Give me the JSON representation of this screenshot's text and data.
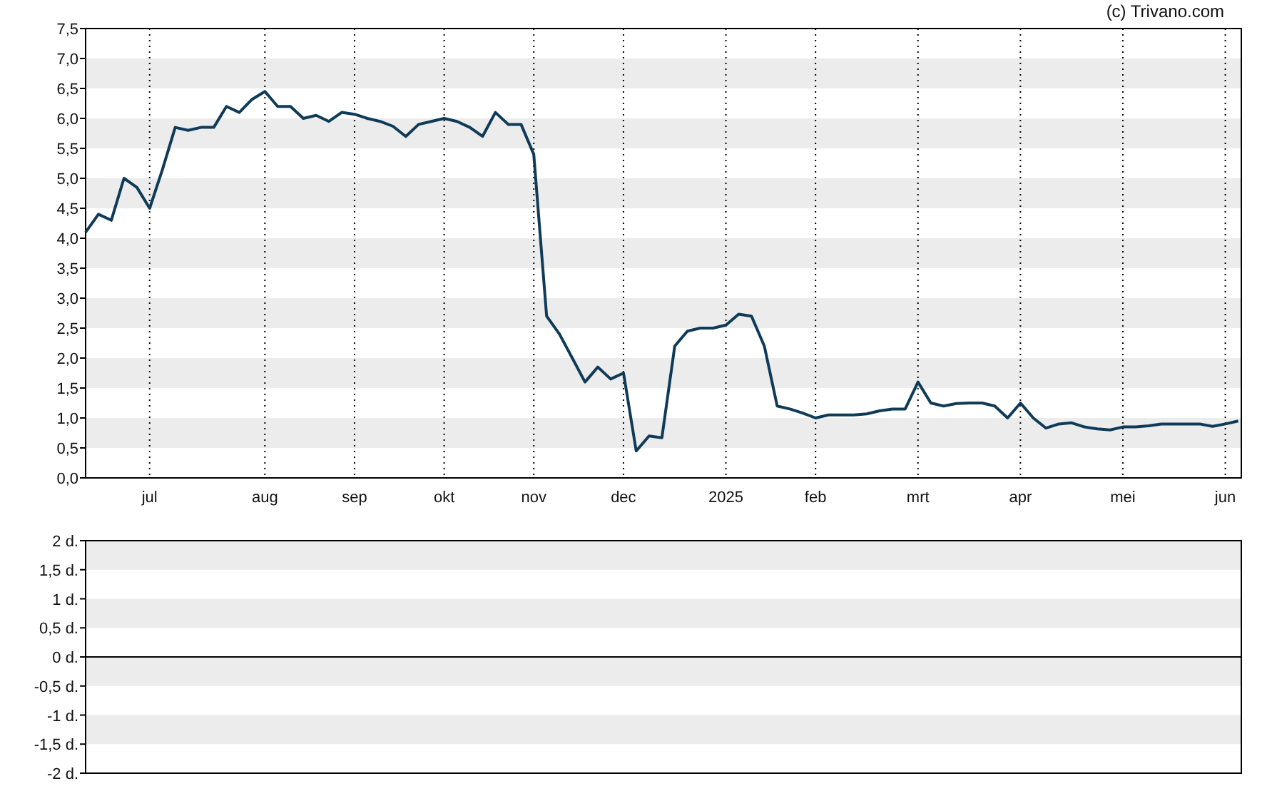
{
  "copyright": "(c) Trivano.com",
  "price_chart": {
    "chart_data": {
      "type": "line",
      "grid": true,
      "ylim": [
        0,
        7.5
      ],
      "yticks": [
        {
          "value": 0,
          "label": "0,0"
        },
        {
          "value": 0.5,
          "label": "0,5"
        },
        {
          "value": 1,
          "label": "1,0"
        },
        {
          "value": 1.5,
          "label": "1,5"
        },
        {
          "value": 2,
          "label": "2,0"
        },
        {
          "value": 2.5,
          "label": "2,5"
        },
        {
          "value": 3,
          "label": "3,0"
        },
        {
          "value": 3.5,
          "label": "3,5"
        },
        {
          "value": 4,
          "label": "4,0"
        },
        {
          "value": 4.5,
          "label": "4,5"
        },
        {
          "value": 5,
          "label": "5,0"
        },
        {
          "value": 5.5,
          "label": "5,5"
        },
        {
          "value": 6,
          "label": "6,0"
        },
        {
          "value": 6.5,
          "label": "6,5"
        },
        {
          "value": 7,
          "label": "7,0"
        },
        {
          "value": 7.5,
          "label": "7,5"
        }
      ],
      "categories": [
        null,
        null,
        null,
        null,
        null,
        "jul",
        null,
        null,
        null,
        null,
        null,
        null,
        null,
        null,
        "aug",
        null,
        null,
        null,
        null,
        null,
        null,
        "sep",
        null,
        null,
        null,
        null,
        null,
        null,
        "okt",
        null,
        null,
        null,
        null,
        null,
        null,
        "nov",
        null,
        null,
        null,
        null,
        null,
        null,
        "dec",
        null,
        null,
        null,
        null,
        null,
        null,
        null,
        "2025",
        null,
        null,
        null,
        null,
        null,
        null,
        "feb",
        null,
        null,
        null,
        null,
        null,
        null,
        null,
        "mrt",
        null,
        null,
        null,
        null,
        null,
        null,
        null,
        "apr",
        null,
        null,
        null,
        null,
        null,
        null,
        null,
        "mei",
        null,
        null,
        null,
        null,
        null,
        null,
        null,
        "jun",
        null
      ],
      "series": [
        {
          "color": "#0f3b59",
          "values": [
            4.1,
            4.4,
            4.3,
            5.0,
            4.85,
            4.5,
            5.15,
            5.85,
            5.8,
            5.85,
            5.85,
            6.2,
            6.1,
            6.32,
            6.45,
            6.2,
            6.2,
            6.0,
            6.05,
            5.95,
            6.1,
            6.07,
            6.0,
            5.95,
            5.87,
            5.7,
            5.9,
            5.95,
            6.0,
            5.95,
            5.85,
            5.7,
            6.1,
            5.9,
            5.9,
            5.4,
            2.7,
            2.4,
            2.0,
            1.6,
            1.85,
            1.65,
            1.75,
            0.45,
            0.7,
            0.67,
            2.2,
            2.45,
            2.5,
            2.5,
            2.55,
            2.73,
            2.7,
            2.2,
            1.2,
            1.15,
            1.08,
            1.0,
            1.05,
            1.05,
            1.05,
            1.07,
            1.12,
            1.15,
            1.15,
            1.6,
            1.25,
            1.2,
            1.24,
            1.25,
            1.25,
            1.2,
            1.0,
            1.25,
            1.0,
            0.83,
            0.9,
            0.92,
            0.85,
            0.82,
            0.8,
            0.85,
            0.85,
            0.87,
            0.9,
            0.9,
            0.9,
            0.9,
            0.86,
            0.9,
            0.95
          ]
        }
      ]
    }
  },
  "days_chart": {
    "chart_data": {
      "type": "line",
      "grid": true,
      "ylim": [
        -2,
        2
      ],
      "categories": [
        null,
        null
      ],
      "yticks": [
        {
          "value": -2,
          "label": "-2 d."
        },
        {
          "value": -1.5,
          "label": "-1,5 d."
        },
        {
          "value": -1,
          "label": "-1 d."
        },
        {
          "value": -0.5,
          "label": "-0,5 d."
        },
        {
          "value": 0,
          "label": "0 d."
        },
        {
          "value": 0.5,
          "label": "0,5 d."
        },
        {
          "value": 1,
          "label": "1 d."
        },
        {
          "value": 1.5,
          "label": "1,5 d."
        },
        {
          "value": 2,
          "label": "2 d."
        }
      ]
    }
  }
}
